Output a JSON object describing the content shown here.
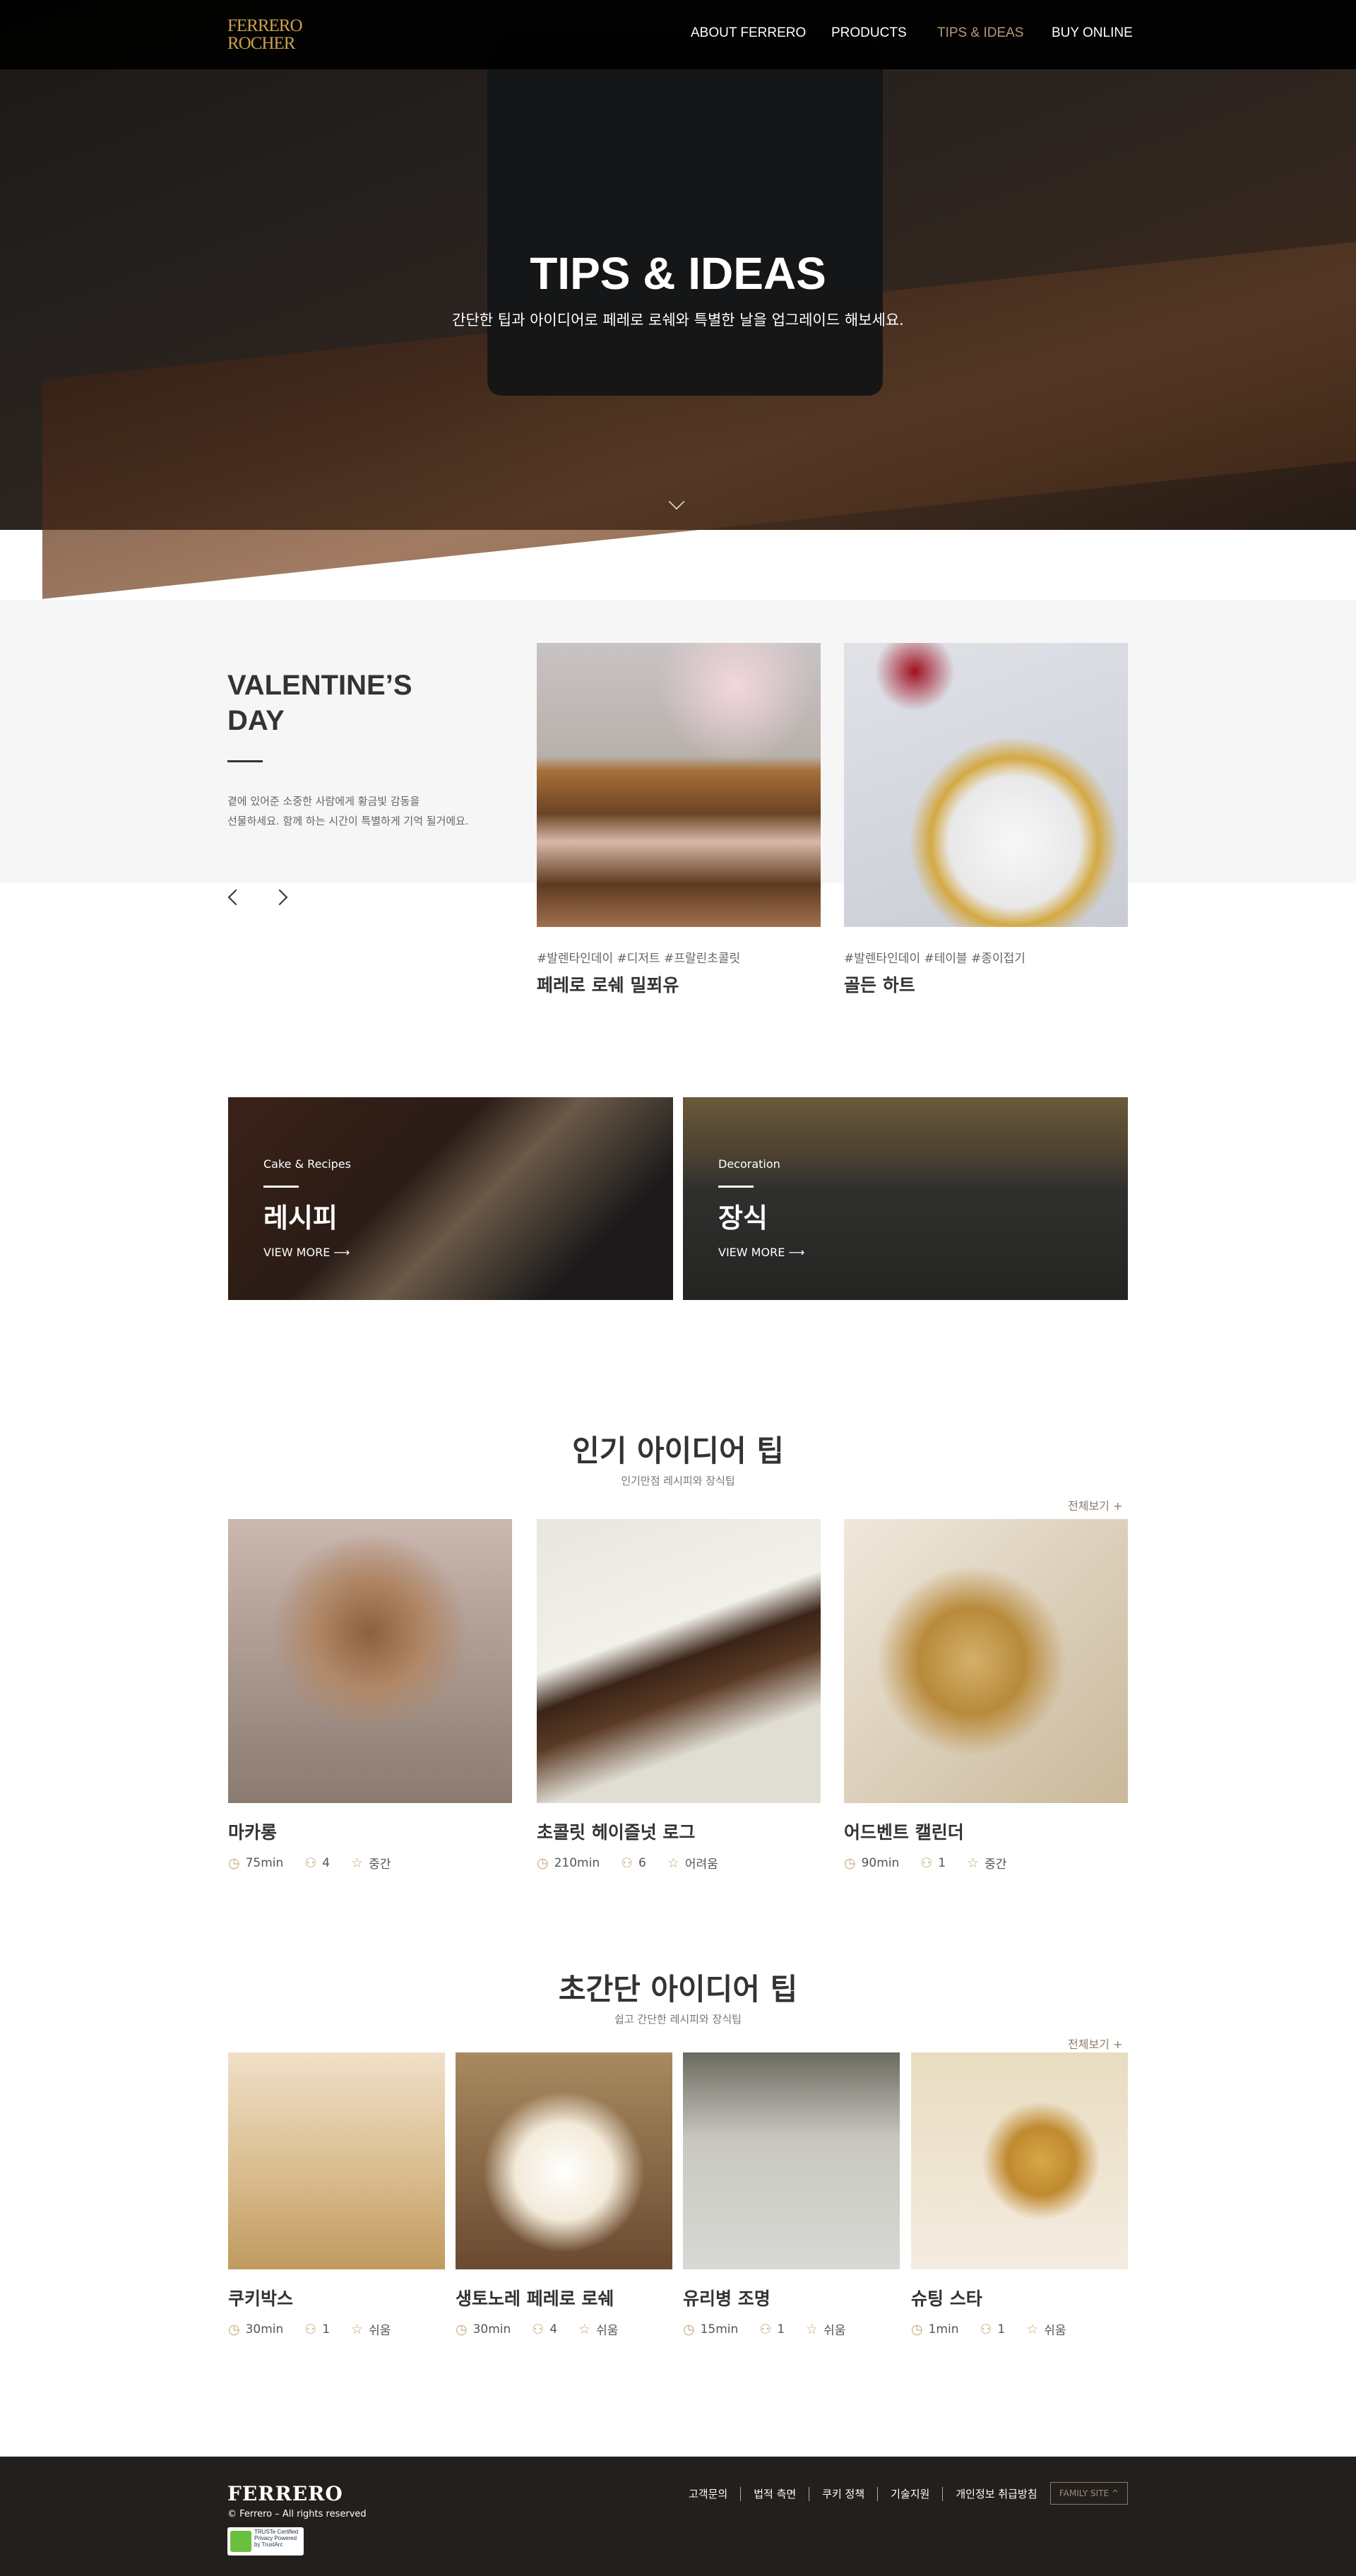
{
  "header": {
    "logo": "FERRERO ROCHER",
    "nav": [
      {
        "label": "ABOUT FERRERO"
      },
      {
        "label": "PRODUCTS"
      },
      {
        "label": "TIPS & IDEAS",
        "active": true
      },
      {
        "label": "BUY ONLINE"
      }
    ],
    "active_color": "#b39a78"
  },
  "hero": {
    "title": "TIPS & IDEAS",
    "subtitle": "간단한 팁과 아이디어로 페레로 로쉐와 특별한 날을 업그레이드 해보세요."
  },
  "featured": {
    "title_line1": "VALENTINE’S",
    "title_line2": "DAY",
    "desc_line1": "곁에 있어준 소중한 사람에게 황금빛 감동을",
    "desc_line2": "선물하세요. 함께 하는 시간이 특별하게 기억 될거에요.",
    "cards": [
      {
        "tags": "#발렌타인데이  #디저트 #프랄린초콜릿",
        "title": "페레로 로쉐 밀푀유"
      },
      {
        "tags": "#발렌타인데이  #테이블 #종이접기",
        "title": "골든 하트"
      }
    ]
  },
  "categories": [
    {
      "eng": "Cake & Recipes",
      "kr": "레시피",
      "cta": "VIEW MORE"
    },
    {
      "eng": "Decoration",
      "kr": "장식",
      "cta": "VIEW MORE"
    }
  ],
  "popular": {
    "title": "인기 아이디어 팁",
    "subtitle": "인기만점 레시피와 장식팁",
    "more": "전체보기",
    "items": [
      {
        "title": "마카롱",
        "time": "75min",
        "people": "4",
        "level": "중간"
      },
      {
        "title": "초콜릿 헤이즐넛 로그",
        "time": "210min",
        "people": "6",
        "level": "어려움"
      },
      {
        "title": "어드벤트 캘린더",
        "time": "90min",
        "people": "1",
        "level": "중간"
      }
    ]
  },
  "quick": {
    "title": "초간단 아이디어 팁",
    "subtitle": "쉽고 간단한 레시피와 장식팁",
    "more": "전체보기",
    "items": [
      {
        "title": "쿠키박스",
        "time": "30min",
        "people": "1",
        "level": "쉬움"
      },
      {
        "title": "생토노레 페레로 로쉐",
        "time": "30min",
        "people": "4",
        "level": "쉬움"
      },
      {
        "title": "유리병 조명",
        "time": "15min",
        "people": "1",
        "level": "쉬움"
      },
      {
        "title": "슈팅 스타",
        "time": "1min",
        "people": "1",
        "level": "쉬움"
      }
    ]
  },
  "footer": {
    "logo": "FERRERO",
    "copyright": "© Ferrero – All rights reserved",
    "badge": "TRUSTe Certified Privacy Powered by TrustArc",
    "links": [
      "고객문의",
      "법적 측면",
      "쿠키 정책",
      "기술지원",
      "개인정보 취급방침"
    ],
    "family_site": "FAMILY SITE"
  }
}
